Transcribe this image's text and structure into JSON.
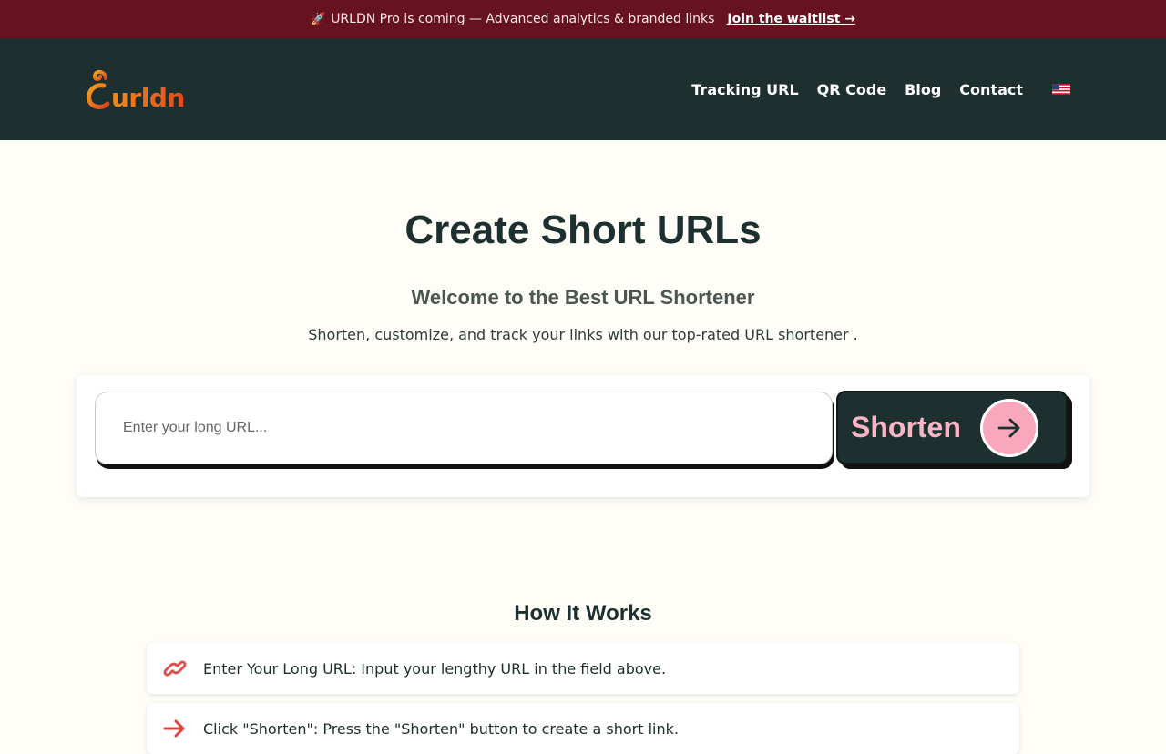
{
  "announcement": {
    "text": "URLDN Pro is coming — Advanced analytics & branded links",
    "cta": "Join the waitlist →"
  },
  "header": {
    "logo_text": "urldn",
    "nav": [
      "Tracking URL",
      "QR Code",
      "Blog",
      "Contact"
    ]
  },
  "hero": {
    "title": "Create Short URLs",
    "subtitle": "Welcome to the Best URL Shortener",
    "description": "Shorten, customize, and track your links with our top-rated URL shortener ."
  },
  "shortener": {
    "placeholder": "Enter your long URL...",
    "button_label": "Shorten"
  },
  "how_it_works": {
    "title": "How It Works",
    "steps": [
      "Enter Your Long URL: Input your lengthy URL in the field above.",
      "Click \"Shorten\": Press the \"Shorten\" button to create a short link."
    ]
  },
  "colors": {
    "announce_bg": "#66131f",
    "header_bg": "#1d2f2e",
    "accent_pink": "#f8a7bd",
    "logo_orange": "#f28a1a"
  },
  "icons": [
    "rocket-icon",
    "curl-logo-icon",
    "us-flag-icon",
    "arrow-right-icon",
    "link-icon",
    "red-arrow-icon"
  ]
}
